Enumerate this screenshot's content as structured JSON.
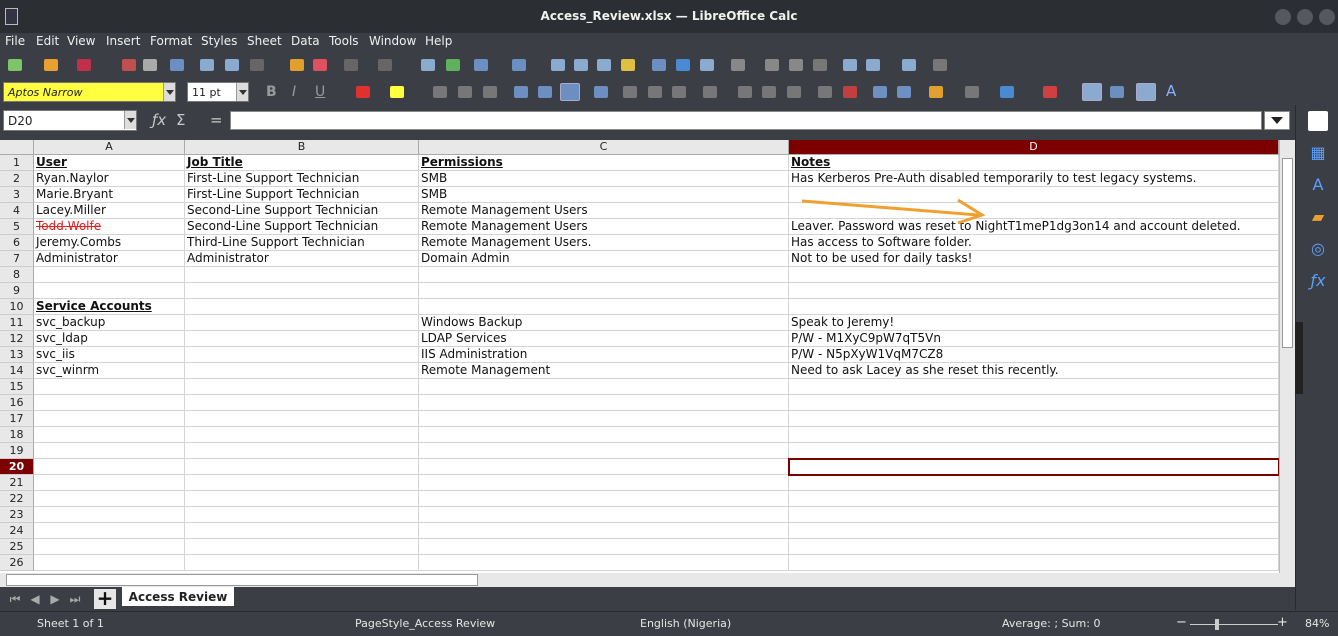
{
  "window": {
    "title": "Access_Review.xlsx — LibreOffice Calc"
  },
  "menu": [
    "File",
    "Edit",
    "View",
    "Insert",
    "Format",
    "Styles",
    "Sheet",
    "Data",
    "Tools",
    "Window",
    "Help"
  ],
  "format": {
    "font_name": "Aptos Narrow",
    "font_size": "11 pt"
  },
  "formula_bar": {
    "cell_ref": "D20",
    "content": ""
  },
  "columns": [
    "A",
    "B",
    "C",
    "D"
  ],
  "rows": [
    "1",
    "2",
    "3",
    "4",
    "5",
    "6",
    "7",
    "8",
    "9",
    "10",
    "11",
    "12",
    "13",
    "14",
    "15",
    "16",
    "17",
    "18",
    "19",
    "20",
    "21",
    "22",
    "23",
    "24",
    "25",
    "26"
  ],
  "cells": {
    "r1": [
      "User",
      "Job Title",
      "Permissions",
      "Notes"
    ],
    "r2": [
      "Ryan.Naylor",
      "First-Line Support Technician",
      "SMB",
      "Has Kerberos Pre-Auth disabled temporarily to test legacy systems."
    ],
    "r3": [
      "Marie.Bryant",
      "First-Line Support Technician",
      "SMB",
      ""
    ],
    "r4": [
      "Lacey.Miller",
      "Second-Line Support Technician",
      "Remote Management Users",
      ""
    ],
    "r5": [
      "Todd.Wolfe",
      "Second-Line Support Technician",
      "Remote Management Users",
      "Leaver. Password was reset to NightT1meP1dg3on14 and account deleted."
    ],
    "r6": [
      "Jeremy.Combs",
      "Third-Line Support Technician",
      "Remote Management Users.",
      "Has access to Software folder."
    ],
    "r7": [
      "Administrator",
      "Administrator",
      "Domain Admin",
      "Not to be used for daily tasks!"
    ],
    "r10": [
      "Service Accounts",
      "",
      "",
      ""
    ],
    "r11": [
      "svc_backup",
      "",
      "Windows Backup",
      "Speak to Jeremy!"
    ],
    "r12": [
      "svc_ldap",
      "",
      "LDAP Services",
      "P/W - M1XyC9pW7qT5Vn"
    ],
    "r13": [
      "svc_iis",
      "",
      "IIS Administration",
      "P/W - N5pXyW1VqM7CZ8"
    ],
    "r14": [
      "svc_winrm",
      "",
      "Remote Management",
      "Need to ask Lacey as she reset this recently."
    ]
  },
  "sheet_tab": "Access Review",
  "status": {
    "sheet": "Sheet 1 of 1",
    "page_style": "PageStyle_Access Review",
    "language": "English (Nigeria)",
    "summary": "Average: ; Sum: 0",
    "zoom": "84%"
  },
  "colors": {
    "active_header": "#7c0000",
    "font_box": "#ffff40",
    "annotation_arrow": "#f0a030",
    "struck_text": "#e02020"
  }
}
